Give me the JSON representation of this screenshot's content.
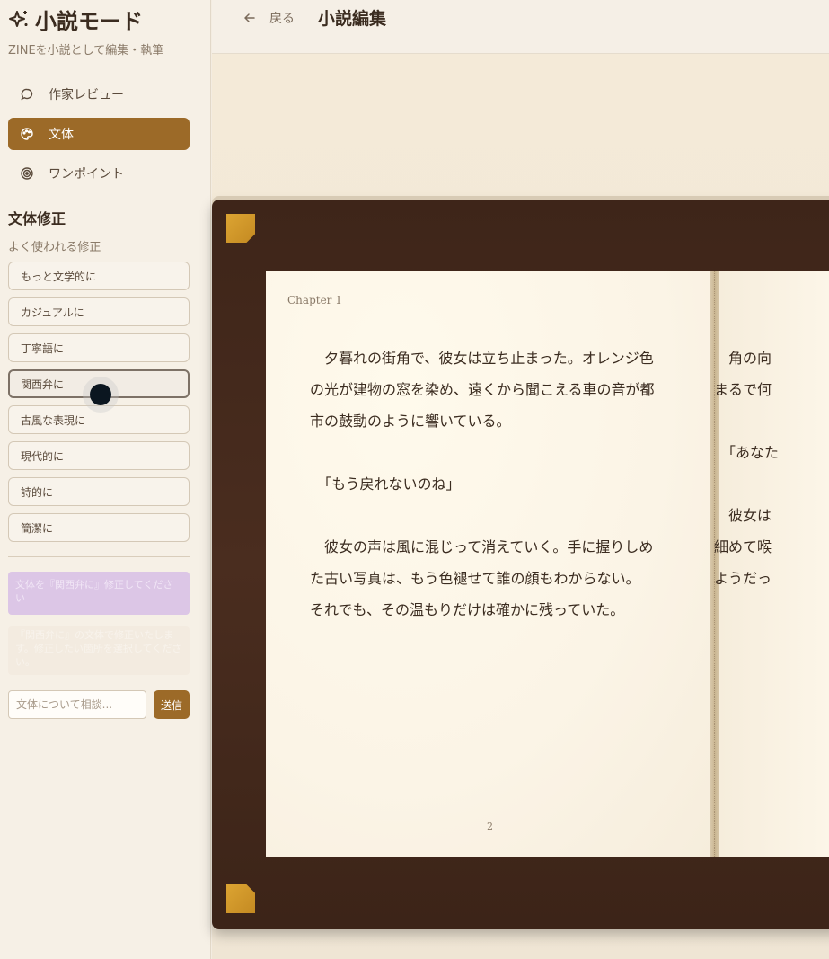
{
  "sidebar": {
    "title": "小説モード",
    "subtitle": "ZINEを小説として編集・執筆",
    "modes": [
      {
        "label": "作家レビュー",
        "icon": "chat-bubble-icon"
      },
      {
        "label": "文体",
        "icon": "palette-icon"
      },
      {
        "label": "ワンポイント",
        "icon": "target-icon"
      }
    ],
    "section_title": "文体修正",
    "section_subtitle": "よく使われる修正",
    "presets": [
      "もっと文学的に",
      "カジュアルに",
      "丁寧語に",
      "関西弁に",
      "古風な表現に",
      "現代的に",
      "詩的に",
      "簡潔に"
    ],
    "chat": {
      "user_message": "文体を『関西弁に』修正してください",
      "assistant_message": "『関西弁に』の文体で修正いたします。修正したい箇所を選択してください。",
      "input_placeholder": "文体について相談...",
      "send_label": "送信"
    }
  },
  "header": {
    "back_label": "戻る",
    "title": "小説編集"
  },
  "book": {
    "left_page": {
      "chapter": "Chapter 1",
      "lines": [
        "夕暮れの街角で、彼女は立ち止まった。オレンジ色",
        "の光が建物の窓を染め、遠くから聞こえる車の音が都",
        "市の鼓動のように響いている。",
        "",
        "「もう戻れないのね」",
        "",
        "彼女の声は風に混じって消えていく。手に握りしめ",
        "た古い写真は、もう色褪せて誰の顔もわからない。",
        "それでも、その温もりだけは確かに残っていた。"
      ],
      "page_number": "2"
    },
    "right_page": {
      "lines": [
        "角の向",
        "まるで何",
        "",
        "「あなた",
        "",
        "彼女は",
        "細めて喉",
        "ようだっ"
      ]
    }
  },
  "colors": {
    "accent": "#9c6a28",
    "book_cover": "#4a2d1f",
    "page": "#fbf4e6",
    "corner": "#d49a2a"
  }
}
